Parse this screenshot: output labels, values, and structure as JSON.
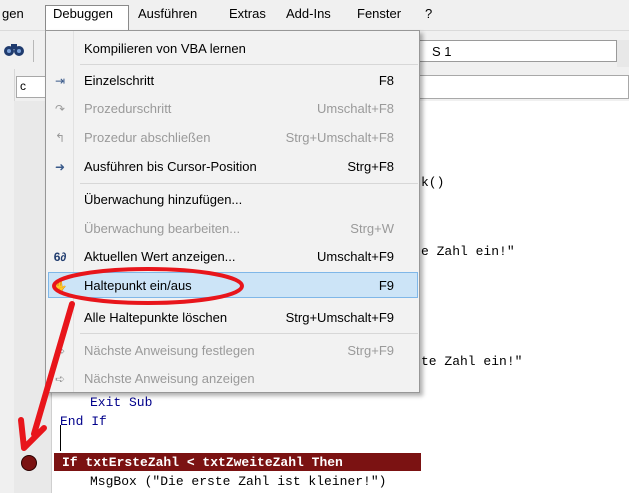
{
  "menubar": {
    "items": [
      {
        "label": "gen"
      },
      {
        "label": "Debuggen"
      },
      {
        "label": "Ausführen"
      },
      {
        "label": "Extras"
      },
      {
        "label": "Add-Ins"
      },
      {
        "label": "Fenster"
      },
      {
        "label": "?"
      }
    ]
  },
  "toolbar": {
    "combo_value": "S 1",
    "code_combo_left": "c"
  },
  "menu": {
    "items": [
      {
        "label": "Kompilieren von VBA lernen",
        "shortcut": "",
        "enabled": true
      },
      {
        "label": "Einzelschritt",
        "shortcut": "F8",
        "enabled": true,
        "icon": "step-into-icon"
      },
      {
        "label": "Prozedurschritt",
        "shortcut": "Umschalt+F8",
        "enabled": false,
        "icon": "step-over-icon"
      },
      {
        "label": "Prozedur abschließen",
        "shortcut": "Strg+Umschalt+F8",
        "enabled": false,
        "icon": "step-out-icon"
      },
      {
        "label": "Ausführen bis Cursor-Position",
        "shortcut": "Strg+F8",
        "enabled": true,
        "icon": "run-to-cursor-icon"
      },
      {
        "label": "Überwachung hinzufügen...",
        "shortcut": "",
        "enabled": true
      },
      {
        "label": "Überwachung bearbeiten...",
        "shortcut": "Strg+W",
        "enabled": false
      },
      {
        "label": "Aktuellen Wert anzeigen...",
        "shortcut": "Umschalt+F9",
        "enabled": true,
        "icon": "quick-watch-icon"
      },
      {
        "label": "Haltepunkt ein/aus",
        "shortcut": "F9",
        "enabled": true,
        "icon": "hand-icon",
        "highlighted": true
      },
      {
        "label": "Alle Haltepunkte löschen",
        "shortcut": "Strg+Umschalt+F9",
        "enabled": true
      },
      {
        "label": "Nächste Anweisung festlegen",
        "shortcut": "Strg+F9",
        "enabled": false,
        "icon": "set-next-icon"
      },
      {
        "label": "Nächste Anweisung anzeigen",
        "shortcut": "",
        "enabled": false,
        "icon": "show-next-icon"
      }
    ]
  },
  "code": {
    "frag_1": "k()",
    "frag_2": "e Zahl ein!\"",
    "frag_3": "te Zahl ein!\"",
    "line_exit": "Exit Sub",
    "line_endif": "End If",
    "line_breakpoint": "If txtErsteZahl < txtZweiteZahl Then",
    "line_msgbox": "MsgBox (\"Die erste Zahl ist kleiner!\")"
  },
  "colors": {
    "breakpoint": "#7b1212",
    "annotation": "#e8151b",
    "highlight": "#cce4f7"
  }
}
